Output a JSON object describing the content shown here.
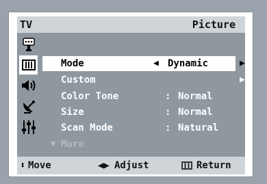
{
  "header": {
    "tv_label": "TV",
    "title": "Picture"
  },
  "sidebar": {
    "icons": [
      "input-icon",
      "picture-icon",
      "sound-icon",
      "channel-icon",
      "setup-icon"
    ],
    "active_index": 1
  },
  "menu": {
    "items": [
      {
        "label": "Mode",
        "value": "Dynamic",
        "selected": true
      },
      {
        "label": "Custom",
        "value": ""
      },
      {
        "label": "Color Tone",
        "value": "Normal"
      },
      {
        "label": "Size",
        "value": "Normal"
      },
      {
        "label": "Scan Mode",
        "value": "Natural"
      }
    ],
    "more_label": "More"
  },
  "footer": {
    "move": "Move",
    "adjust": "Adjust",
    "return": "Return"
  },
  "colors": {
    "frame": "#8f989f",
    "bar": "#cfd4d8",
    "highlight": "#ffffff",
    "background": "#9aa3ab"
  }
}
